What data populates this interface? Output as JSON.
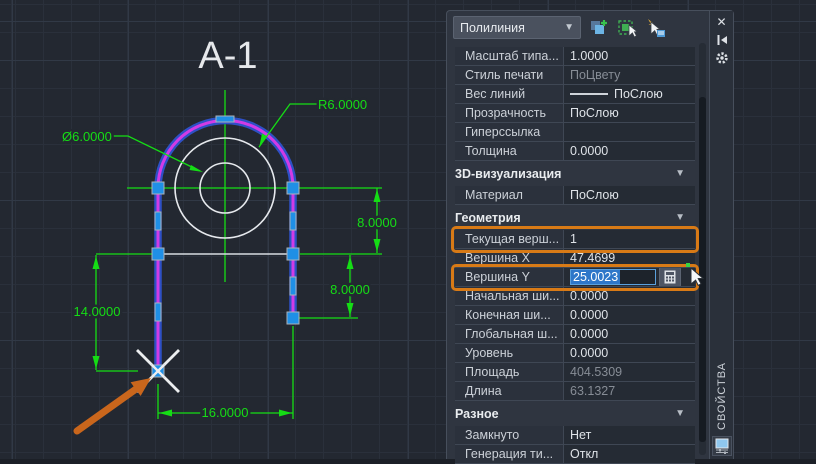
{
  "drawing": {
    "title": "А-1",
    "labels": {
      "radius": "R6.0000",
      "diameter": "Ø6.0000",
      "right_upper": "8.0000",
      "right_lower": "8.0000",
      "left": "14.0000",
      "bottom": "16.0000"
    },
    "colors": {
      "dimension_green": "#15dd15",
      "polyline_core": "#d13be6",
      "polyline_glow": "#2f52cf",
      "grip_blue": "#1f8fe6",
      "annotation_orange": "#c9661c",
      "geometry_white": "#e6e9ed"
    }
  },
  "palette": {
    "selector": {
      "value": "Полилиния"
    },
    "toolbar": {
      "pickadd": "toggle-pickadd",
      "quick_select": "quick-select",
      "select_objects": "select-objects"
    },
    "titlebar": {
      "title": "СВОЙСТВА",
      "close": "✕"
    },
    "groups": [
      {
        "header": "",
        "rows": [
          {
            "label": "Масштаб типа...",
            "value": "1.0000"
          },
          {
            "label": "Стиль печати",
            "value": "ПоЦвету",
            "muted": true
          },
          {
            "label": "Вес линий",
            "value": "ПоСлою",
            "lineweight": true
          },
          {
            "label": "Прозрачность",
            "value": "ПоСлою"
          },
          {
            "label": "Гиперссылка",
            "value": ""
          },
          {
            "label": "Толщина",
            "value": "0.0000"
          }
        ]
      },
      {
        "header": "3D-визуализация",
        "rows": [
          {
            "label": "Материал",
            "value": "ПоСлою"
          }
        ]
      },
      {
        "header": "Геометрия",
        "rows": [
          {
            "label": "Текущая верш...",
            "value": "1",
            "highlight": true
          },
          {
            "label": "Вершина X",
            "value": "47.4699"
          },
          {
            "label": "Вершина Y",
            "value": "25.0023",
            "highlight": true,
            "editing": true
          },
          {
            "label": "Начальная ши...",
            "value": "0.0000"
          },
          {
            "label": "Конечная ши...",
            "value": "0.0000"
          },
          {
            "label": "Глобальная ш...",
            "value": "0.0000"
          },
          {
            "label": "Уровень",
            "value": "0.0000"
          },
          {
            "label": "Площадь",
            "value": "404.5309",
            "muted": true
          },
          {
            "label": "Длина",
            "value": "63.1327",
            "muted": true
          }
        ]
      },
      {
        "header": "Разное",
        "rows": [
          {
            "label": "Замкнуто",
            "value": "Нет"
          },
          {
            "label": "Генерация ти...",
            "value": "Откл"
          }
        ]
      }
    ]
  }
}
